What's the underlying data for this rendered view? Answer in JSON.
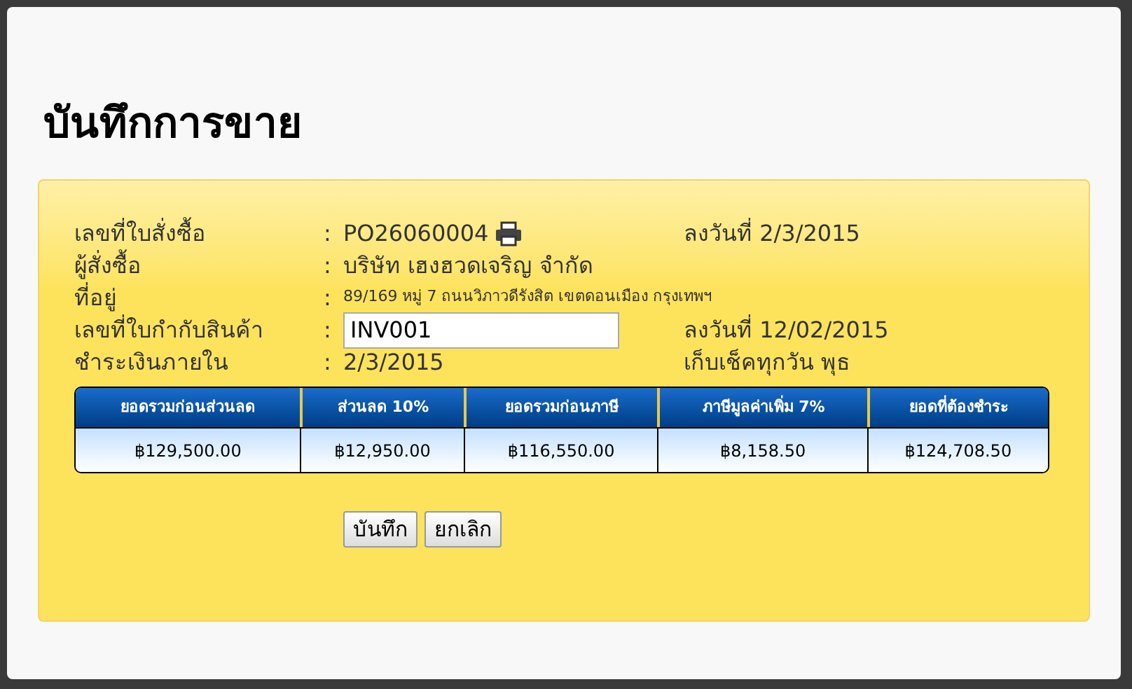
{
  "dialog": {
    "title": "บันทึกการขาย"
  },
  "rows": [
    {
      "label": "เลขที่ใบสั่งซื้อ",
      "separator": ":",
      "value": "PO26060004",
      "kind": "print",
      "aside": "ลงวันที่ 2/3/2015"
    },
    {
      "label": "ผู้สั่งซื้อ",
      "separator": ":",
      "value": "บริษัท เฮงฮวดเจริญ จำกัด",
      "kind": "text"
    },
    {
      "label": "ที่อยู่",
      "separator": ":",
      "value": "89/169 หมู่ 7 ถนนวิภาวดีรังสิต เขตดอนเมือง กรุงเทพฯ",
      "kind": "small"
    },
    {
      "label": "เลขที่ใบกำกับสินค้า",
      "separator": ":",
      "value": "INV001",
      "kind": "input",
      "aside": "ลงวันที่ 12/02/2015"
    },
    {
      "label": "ชำระเงินภายใน",
      "separator": ":",
      "value": "2/3/2015",
      "kind": "text",
      "aside": "เก็บเช็คทุกวัน พุธ"
    }
  ],
  "table": {
    "columns": [
      "ยอดรวมก่อนส่วนลด",
      "ส่วนลด 10%",
      "ยอดรวมก่อนภาษี",
      "ภาษีมูลค่าเพิ่ม 7%",
      "ยอดที่ต้องชำระ"
    ],
    "rows": [
      [
        "฿129,500.00",
        "฿12,950.00",
        "฿116,550.00",
        "฿8,158.50",
        "฿124,708.50"
      ]
    ]
  },
  "buttons": [
    "บันทึก",
    "ยกเลิก"
  ]
}
